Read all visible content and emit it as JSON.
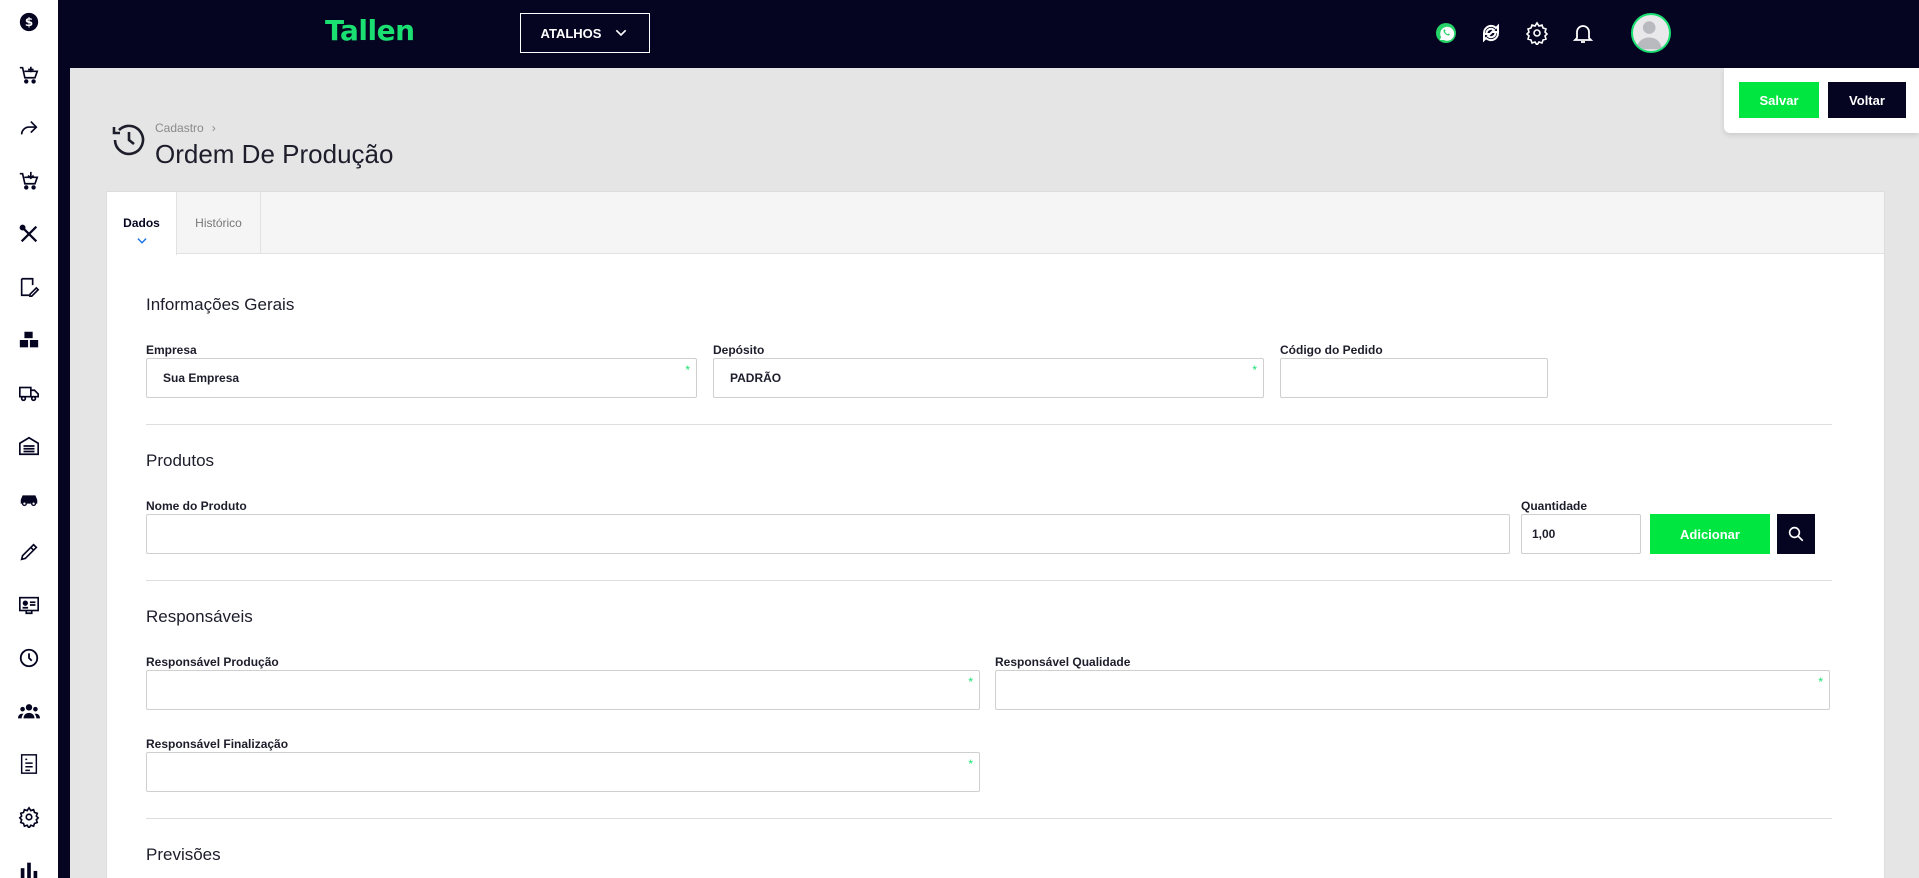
{
  "app": {
    "brand": "Tallen",
    "shortcut_label": "ATALHOS"
  },
  "colors": {
    "brand_green": "#19e071",
    "navy": "#050522",
    "action_green": "#00e640"
  },
  "sidebar": {
    "items": [
      {
        "icon": "dollar-icon"
      },
      {
        "icon": "cart-add-icon"
      },
      {
        "icon": "share-arrow-icon"
      },
      {
        "icon": "cart-download-icon"
      },
      {
        "icon": "tools-icon"
      },
      {
        "icon": "edit-note-icon"
      },
      {
        "icon": "boxes-icon"
      },
      {
        "icon": "truck-icon"
      },
      {
        "icon": "warehouse-icon"
      },
      {
        "icon": "car-icon"
      },
      {
        "icon": "pencil-icon"
      },
      {
        "icon": "id-card-icon"
      },
      {
        "icon": "clock-icon"
      },
      {
        "icon": "users-icon"
      },
      {
        "icon": "report-icon"
      },
      {
        "icon": "gear-icon"
      },
      {
        "icon": "bar-chart-icon"
      }
    ]
  },
  "topbar": {
    "icons": [
      "whatsapp-icon",
      "sync-icon",
      "gear-icon",
      "bell-icon",
      "avatar"
    ]
  },
  "actions": {
    "save_label": "Salvar",
    "back_label": "Voltar"
  },
  "header": {
    "breadcrumb": "Cadastro",
    "title": "Ordem De Produção"
  },
  "tabs": [
    {
      "label": "Dados",
      "active": true
    },
    {
      "label": "Histórico",
      "active": false
    }
  ],
  "sections": {
    "general": {
      "title": "Informações Gerais",
      "empresa_label": "Empresa",
      "empresa_value": "Sua Empresa",
      "deposito_label": "Depósito",
      "deposito_value": "PADRÃO",
      "codigo_label": "Código do Pedido",
      "codigo_value": ""
    },
    "products": {
      "title": "Produtos",
      "nome_label": "Nome do Produto",
      "nome_value": "",
      "quantidade_label": "Quantidade",
      "quantidade_value": "1,00",
      "add_label": "Adicionar"
    },
    "responsibles": {
      "title": "Responsáveis",
      "producao_label": "Responsável Produção",
      "qualidade_label": "Responsável Qualidade",
      "finalizacao_label": "Responsável Finalização"
    },
    "forecasts": {
      "title": "Previsões"
    }
  },
  "required_marker": "*"
}
